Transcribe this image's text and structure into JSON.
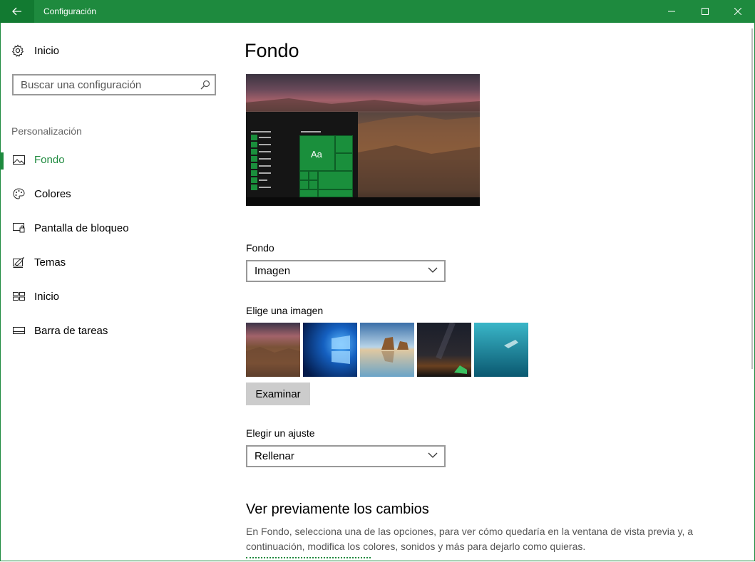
{
  "window": {
    "title": "Configuración"
  },
  "sidebar": {
    "home_label": "Inicio",
    "search_placeholder": "Buscar una configuración",
    "section_label": "Personalización",
    "items": [
      {
        "label": "Fondo",
        "icon": "image-icon",
        "active": true
      },
      {
        "label": "Colores",
        "icon": "palette-icon",
        "active": false
      },
      {
        "label": "Pantalla de bloqueo",
        "icon": "lock-screen-icon",
        "active": false
      },
      {
        "label": "Temas",
        "icon": "themes-icon",
        "active": false
      },
      {
        "label": "Inicio",
        "icon": "start-icon",
        "active": false
      },
      {
        "label": "Barra de tareas",
        "icon": "taskbar-icon",
        "active": false
      }
    ]
  },
  "main": {
    "title": "Fondo",
    "preview": {
      "tile_label": "Aa"
    },
    "background": {
      "label": "Fondo",
      "value": "Imagen"
    },
    "image_picker": {
      "label": "Elige una imagen",
      "thumbnails": [
        "canyon-thumbnail",
        "windows-logo-thumbnail",
        "beach-rocks-thumbnail",
        "night-sky-thumbnail",
        "underwater-thumbnail"
      ],
      "browse_label": "Examinar"
    },
    "fit": {
      "label": "Elegir un ajuste",
      "value": "Rellenar"
    },
    "preview_changes": {
      "heading": "Ver previamente los cambios",
      "description": "En Fondo, selecciona una de las opciones, para ver cómo quedaría en la ventana de vista previa y, a continuación, modifica los colores, sonidos y más para dejarlo como quieras."
    }
  },
  "colors": {
    "accent": "#1e8a3e",
    "titlebar": "#1e8a3e"
  }
}
